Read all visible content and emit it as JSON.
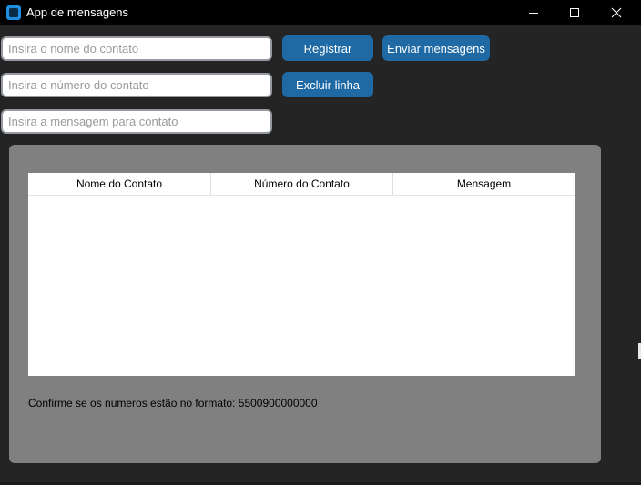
{
  "window": {
    "title": "App de mensagens",
    "icon": "app-window-icon",
    "controls": [
      "minimize-icon",
      "maximize-icon",
      "close-icon"
    ]
  },
  "form": {
    "name_placeholder": "Insira o nome do contato",
    "number_placeholder": "Insira o número do contato",
    "message_placeholder": "Insira a mensagem para contato",
    "name_value": "",
    "number_value": "",
    "message_value": ""
  },
  "buttons": {
    "register": "Registrar",
    "send": "Enviar mensagens",
    "delete_row": "Excluir linha"
  },
  "table": {
    "columns": [
      "Nome do Contato",
      "Número do Contato",
      "Mensagem"
    ],
    "rows": []
  },
  "note": "Confirme se os numeros estão no formato: 5500900000000",
  "colors": {
    "background": "#242424",
    "titlebar": "#000000",
    "accent": "#1F6AA5",
    "panel": "#808080",
    "table": "#FFFFFF"
  }
}
